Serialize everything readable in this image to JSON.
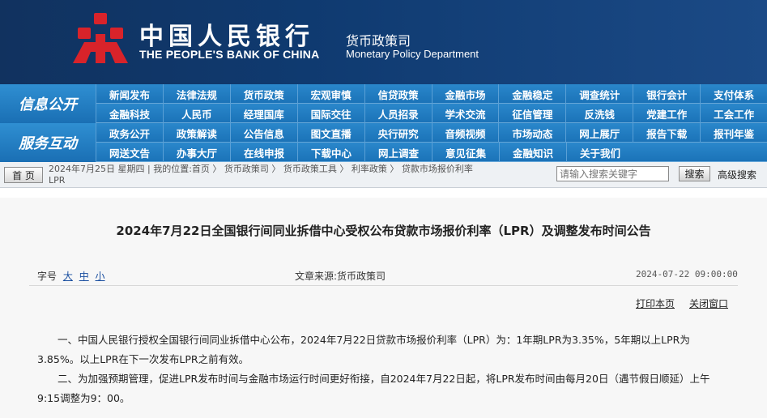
{
  "header": {
    "cn_name": "中国人民银行",
    "en_name": "THE PEOPLE'S BANK OF CHINA",
    "dept_cn": "货币政策司",
    "dept_en": "Monetary Policy Department",
    "emblem_color": "#d8232a"
  },
  "nav": {
    "info_label": "信息公开",
    "service_label": "服务互动",
    "row1": [
      "新闻发布",
      "法律法规",
      "货币政策",
      "宏观审慎",
      "信贷政策",
      "金融市场",
      "金融稳定",
      "调查统计",
      "银行会计",
      "支付体系"
    ],
    "row2": [
      "金融科技",
      "人民币",
      "经理国库",
      "国际交往",
      "人员招录",
      "学术交流",
      "征信管理",
      "反洗钱",
      "党建工作",
      "工会工作"
    ],
    "row3": [
      "政务公开",
      "政策解读",
      "公告信息",
      "图文直播",
      "央行研究",
      "音频视频",
      "市场动态",
      "网上展厅",
      "报告下载",
      "报刊年鉴"
    ],
    "row4": [
      "网送文告",
      "办事大厅",
      "在线申报",
      "下载中心",
      "网上调查",
      "意见征集",
      "金融知识",
      "关于我们"
    ]
  },
  "crumbbar": {
    "home_label": "首 页",
    "date_text": "2024年7月25日 星期四",
    "location": "我的位置:首页",
    "crumbs": [
      "货币政策司",
      "货币政策工具",
      "利率政策",
      "贷款市场报价利率"
    ],
    "crumb_tail": "LPR",
    "search_placeholder": "请输入搜索关键字",
    "search_label": "搜索",
    "advanced_label": "高级搜索"
  },
  "article": {
    "title": "2024年7月22日全国银行间同业拆借中心受权公布贷款市场报价利率（LPR）及调整发布时间公告",
    "font_label": "字号",
    "font_large": "大",
    "font_medium": "中",
    "font_small": "小",
    "source": "文章来源:货币政策司",
    "date": "2024-07-22 09:00:00",
    "print_label": "打印本页",
    "close_label": "关闭窗口",
    "para1": "一、中国人民银行授权全国银行间同业拆借中心公布，2024年7月22日贷款市场报价利率（LPR）为：1年期LPR为3.35%，5年期以上LPR为3.85%。以上LPR在下一次发布LPR之前有效。",
    "para2": "二、为加强预期管理，促进LPR发布时间与金融市场运行时间更好衔接，自2024年7月22日起，将LPR发布时间由每月20日（遇节假日顺延）上午9:15调整为9：00。"
  }
}
